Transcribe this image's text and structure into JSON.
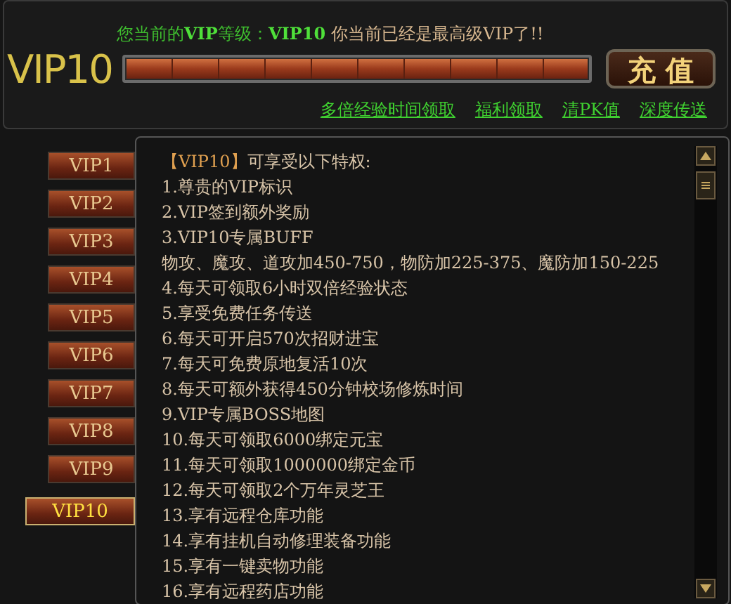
{
  "header": {
    "vip_level": "VIP10",
    "status_highlight": "您当前的**VIP**等级：**VIP10**",
    "status_note": "你当前已经是最高级VIP了!!",
    "progress": {
      "level": 1
    },
    "recharge_button": "充 值",
    "links": [
      "多倍经验时间领取",
      "福利领取",
      "清PK值",
      "深度传送"
    ]
  },
  "tabs": [
    {
      "label": "VIP1",
      "selected": false
    },
    {
      "label": "VIP2",
      "selected": false
    },
    {
      "label": "VIP3",
      "selected": false
    },
    {
      "label": "VIP4",
      "selected": false
    },
    {
      "label": "VIP5",
      "selected": false
    },
    {
      "label": "VIP6",
      "selected": false
    },
    {
      "label": "VIP7",
      "selected": false
    },
    {
      "label": "VIP8",
      "selected": false
    },
    {
      "label": "VIP9",
      "selected": false
    },
    {
      "label": "VIP10",
      "selected": true
    }
  ],
  "benefits": {
    "title_tag": "【VIP10】",
    "title": "可享受以下特权:",
    "lines": [
      "1.尊贵的VIP标识",
      "2.VIP签到额外奖励",
      "3.VIP10专属BUFF",
      "物攻、魔攻、道攻加450-750，物防加225-375、魔防加150-225",
      "4.每天可领取6小时双倍经验状态",
      "5.享受免费任务传送",
      "6.每天可开启570次招财进宝",
      "7.每天可免费原地复活10次",
      "8.每天可额外获得450分钟校场修炼时间",
      "9.VIP专属BOSS地图",
      "10.每天可领取6000绑定元宝",
      "11.每天可领取1000000绑定金币",
      "12.每天可领取2个万年灵芝王",
      "13.享有远程仓库功能",
      "14.享有挂机自动修理装备功能",
      "15.享有一键卖物功能",
      "16.享有远程药店功能"
    ]
  }
}
